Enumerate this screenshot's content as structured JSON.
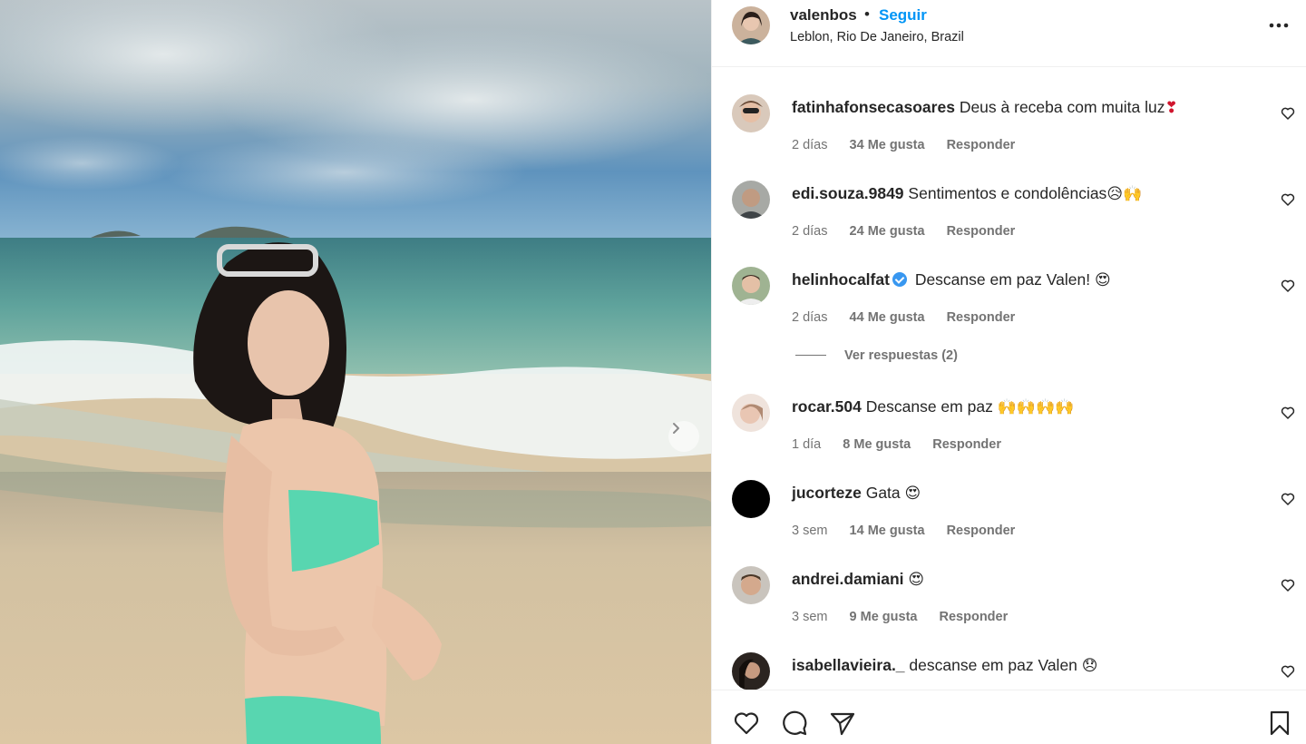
{
  "post": {
    "username": "valenbos",
    "separator": "•",
    "follow_label": "Seguir",
    "location": "Leblon, Rio De Janeiro, Brazil",
    "more_icon": "more-horizontal-icon"
  },
  "photo": {
    "next_icon": "chevron-right-icon"
  },
  "comments": [
    {
      "user": "fatinhafonsecasoares",
      "text": "Deus à receba com muita luz",
      "emoji": "❣",
      "time": "2 días",
      "likes": "34 Me gusta",
      "reply": "Responder"
    },
    {
      "user": "edi.souza.9849",
      "text": "Sentimentos e condolências",
      "emoji": "😥🙌",
      "time": "2 días",
      "likes": "24 Me gusta",
      "reply": "Responder"
    },
    {
      "user": "helinhocalfat",
      "text": "Descanse em paz Valen!",
      "emoji": "😍",
      "time": "2 días",
      "likes": "44 Me gusta",
      "reply": "Responder",
      "verified": true
    },
    {
      "user": "rocar.504",
      "text": "Descanse em paz",
      "emoji": "🙌🙌🙌🙌",
      "time": "1 día",
      "likes": "8 Me gusta",
      "reply": "Responder"
    },
    {
      "user": "jucorteze",
      "text": "Gata",
      "emoji": "😍",
      "time": "3 sem",
      "likes": "14 Me gusta",
      "reply": "Responder"
    },
    {
      "user": "andrei.damiani",
      "text": "",
      "emoji": "😍",
      "time": "3 sem",
      "likes": "9 Me gusta",
      "reply": "Responder"
    },
    {
      "user": "isabellavieira._",
      "text": "descanse em paz Valen",
      "emoji": "😞",
      "time": "",
      "likes": "",
      "reply": ""
    }
  ],
  "view_replies": "Ver respuestas (2)",
  "actions": {
    "like_icon": "heart-icon",
    "comment_icon": "comment-icon",
    "share_icon": "send-icon",
    "save_icon": "bookmark-icon"
  },
  "colors": {
    "link_blue": "#0095f6",
    "meta_gray": "#737373",
    "text": "#262626",
    "verified_blue": "#3897f0"
  }
}
